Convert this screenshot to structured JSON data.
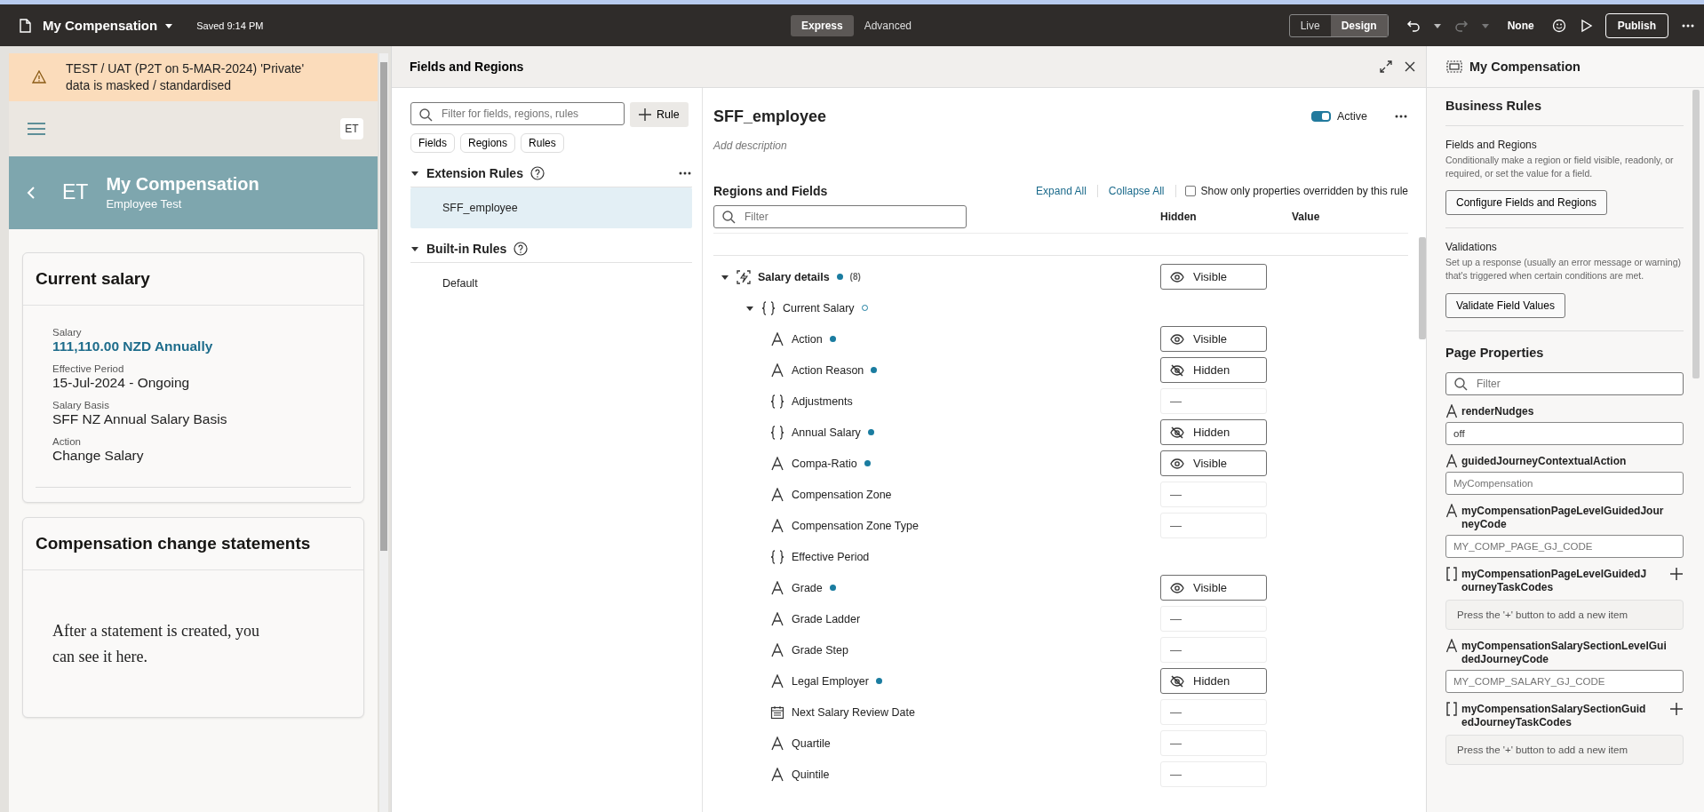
{
  "topbar": {
    "page_title": "My Compensation",
    "saved": "Saved 9:14 PM",
    "modes": [
      {
        "label": "Express",
        "selected": true
      },
      {
        "label": "Advanced",
        "selected": false
      }
    ],
    "views": [
      {
        "label": "Live",
        "selected": false
      },
      {
        "label": "Design",
        "selected": true
      }
    ],
    "theme": "None",
    "publish": "Publish"
  },
  "preview": {
    "banner": "TEST / UAT (P2T on 5-MAR-2024) 'Private' data is masked / standardised",
    "avatar": "ET",
    "header": {
      "initials": "ET",
      "title": "My Compensation",
      "subtitle": "Employee Test"
    },
    "salary_card": {
      "title": "Current salary",
      "fields": [
        {
          "label": "Salary",
          "value": "111,110.00 NZD Annually",
          "kind": "highlight"
        },
        {
          "label": "Effective Period",
          "value": "15-Jul-2024 - Ongoing",
          "kind": "plain"
        },
        {
          "label": "Salary Basis",
          "value": "SFF NZ Annual Salary Basis",
          "kind": "plain"
        },
        {
          "label": "Action",
          "value": "Change Salary",
          "kind": "plain"
        }
      ]
    },
    "statements_card": {
      "title": "Compensation change statements",
      "message": "After a statement is created, you can see it here."
    }
  },
  "fields_panel": {
    "title": "Fields and Regions"
  },
  "rules_panel": {
    "filter_placeholder": "Filter for fields, regions, rules",
    "add_rule": "Rule",
    "chips": [
      "Fields",
      "Regions",
      "Rules"
    ],
    "groups": [
      {
        "title": "Extension Rules",
        "expanded": true,
        "menu": true,
        "rules": [
          {
            "label": "SFF_employee",
            "selected": true
          }
        ]
      },
      {
        "title": "Built-in Rules",
        "expanded": true,
        "menu": false,
        "rules": [
          {
            "label": "Default",
            "selected": false
          }
        ]
      }
    ]
  },
  "editor": {
    "rule_name": "SFF_employee",
    "active": true,
    "active_label": "Active",
    "description_placeholder": "Add description",
    "section_title": "Regions and Fields",
    "expand_all": "Expand All",
    "collapse_all": "Collapse All",
    "override_only": {
      "label": "Show only properties overridden by this rule",
      "checked": false
    },
    "filter_placeholder": "Filter",
    "columns": [
      "Hidden",
      "Value"
    ],
    "tree": [
      {
        "label": "Salary details",
        "kind": "region",
        "expanded": true,
        "overridden": true,
        "count": "(8)",
        "control": {
          "kind": "visible",
          "label": "Visible"
        },
        "children": [
          {
            "label": "Current Salary",
            "kind": "object",
            "expanded": true,
            "overridden": false,
            "partial": true,
            "children": [
              {
                "label": "Action",
                "kind": "text",
                "overridden": true,
                "control": {
                  "kind": "visible",
                  "label": "Visible"
                }
              },
              {
                "label": "Action Reason",
                "kind": "text",
                "overridden": true,
                "control": {
                  "kind": "hidden",
                  "label": "Hidden"
                }
              },
              {
                "label": "Adjustments",
                "kind": "object",
                "overridden": false,
                "control": {
                  "kind": "unset",
                  "label": "—"
                }
              },
              {
                "label": "Annual Salary",
                "kind": "object",
                "overridden": true,
                "control": {
                  "kind": "hidden",
                  "label": "Hidden"
                }
              },
              {
                "label": "Compa-Ratio",
                "kind": "text",
                "overridden": true,
                "control": {
                  "kind": "visible",
                  "label": "Visible"
                }
              },
              {
                "label": "Compensation Zone",
                "kind": "text",
                "overridden": false,
                "control": {
                  "kind": "unset",
                  "label": "—"
                }
              },
              {
                "label": "Compensation Zone Type",
                "kind": "text",
                "overridden": false,
                "control": {
                  "kind": "unset",
                  "label": "—"
                }
              },
              {
                "label": "Effective Period",
                "kind": "object",
                "overridden": false
              },
              {
                "label": "Grade",
                "kind": "text",
                "overridden": true,
                "control": {
                  "kind": "visible",
                  "label": "Visible"
                }
              },
              {
                "label": "Grade Ladder",
                "kind": "text",
                "overridden": false,
                "control": {
                  "kind": "unset",
                  "label": "—"
                }
              },
              {
                "label": "Grade Step",
                "kind": "text",
                "overridden": false,
                "control": {
                  "kind": "unset",
                  "label": "—"
                }
              },
              {
                "label": "Legal Employer",
                "kind": "text",
                "overridden": true,
                "control": {
                  "kind": "hidden",
                  "label": "Hidden"
                }
              },
              {
                "label": "Next Salary Review Date",
                "kind": "date",
                "overridden": false,
                "control": {
                  "kind": "unset",
                  "label": "—"
                }
              },
              {
                "label": "Quartile",
                "kind": "text",
                "overridden": false,
                "control": {
                  "kind": "unset",
                  "label": "—"
                }
              },
              {
                "label": "Quintile",
                "kind": "text",
                "overridden": false,
                "control": {
                  "kind": "unset",
                  "label": "—"
                }
              }
            ]
          }
        ]
      }
    ]
  },
  "properties_panel": {
    "title": "My Compensation",
    "business_rules_title": "Business Rules",
    "sections": [
      {
        "title": "Fields and Regions",
        "description": "Conditionally make a region or field visible, readonly, or required, or set the value for a field.",
        "button": "Configure Fields and Regions"
      },
      {
        "title": "Validations",
        "description": "Set up a response (usually an error message or warning) that's triggered when certain conditions are met.",
        "button": "Validate Field Values"
      }
    ],
    "page_properties_title": "Page Properties",
    "filter_placeholder": "Filter",
    "properties": [
      {
        "name": "renderNudges",
        "kind": "string",
        "value": "off"
      },
      {
        "name": "guidedJourneyContextualAction",
        "kind": "string",
        "placeholder": "MyCompensation"
      },
      {
        "name": "myCompensationPageLevelGuidedJourneyCode",
        "kind": "string",
        "placeholder": "MY_COMP_PAGE_GJ_CODE"
      },
      {
        "name": "myCompensationPageLevelGuidedJourneyTaskCodes",
        "kind": "array",
        "empty_message": "Press the '+' button to add a new item"
      },
      {
        "name": "myCompensationSalarySectionLevelGuidedJourneyCode",
        "kind": "string",
        "placeholder": "MY_COMP_SALARY_GJ_CODE"
      },
      {
        "name": "myCompensationSalarySectionGuidedJourneyTaskCodes",
        "kind": "array",
        "empty_message": "Press the '+' button to add a new item"
      }
    ]
  }
}
